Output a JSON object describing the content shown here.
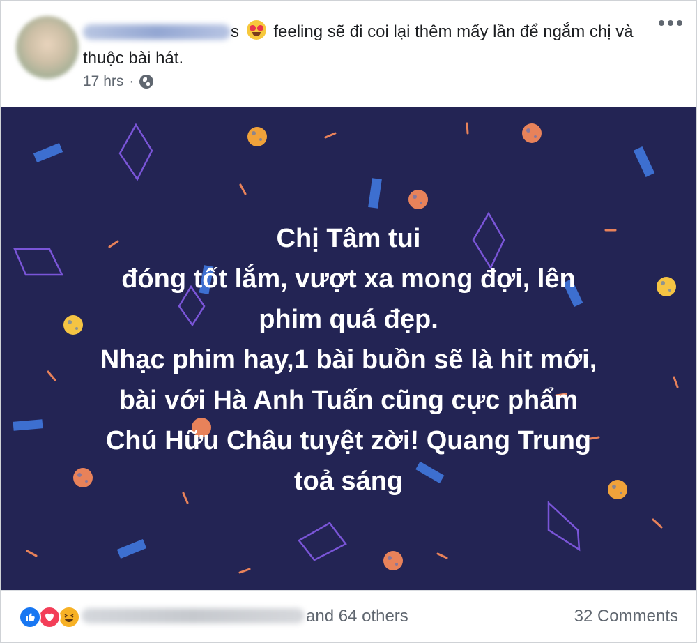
{
  "post": {
    "caption_prefix": "s",
    "caption_text": "feeling sẽ đi coi lại thêm mấy lần để ngắm chị và thuộc bài hát.",
    "timestamp": "17 hrs",
    "privacy_icon": "globe-icon",
    "menu_icon": "more-options-icon",
    "text_lines": [
      "Chị Tâm tui",
      "đóng tốt lắm, vượt xa mong đợi, lên",
      "phim quá đẹp.",
      "Nhạc phim hay,1 bài buồn sẽ là hit mới,",
      "bài với Hà Anh Tuấn cũng cực phẩm",
      "Chú Hữu Châu tuyệt zời! Quang Trung",
      "toả sáng"
    ],
    "background_color": "#232454"
  },
  "footer": {
    "reaction_icons": [
      "like-icon",
      "love-icon",
      "haha-icon"
    ],
    "others_text": "and 64 others",
    "comments_text": "32 Comments"
  },
  "colors": {
    "text_primary": "#1c1e21",
    "text_secondary": "#606770",
    "like": "#1877f2",
    "love": "#f33e58",
    "haha": "#f7b125"
  }
}
